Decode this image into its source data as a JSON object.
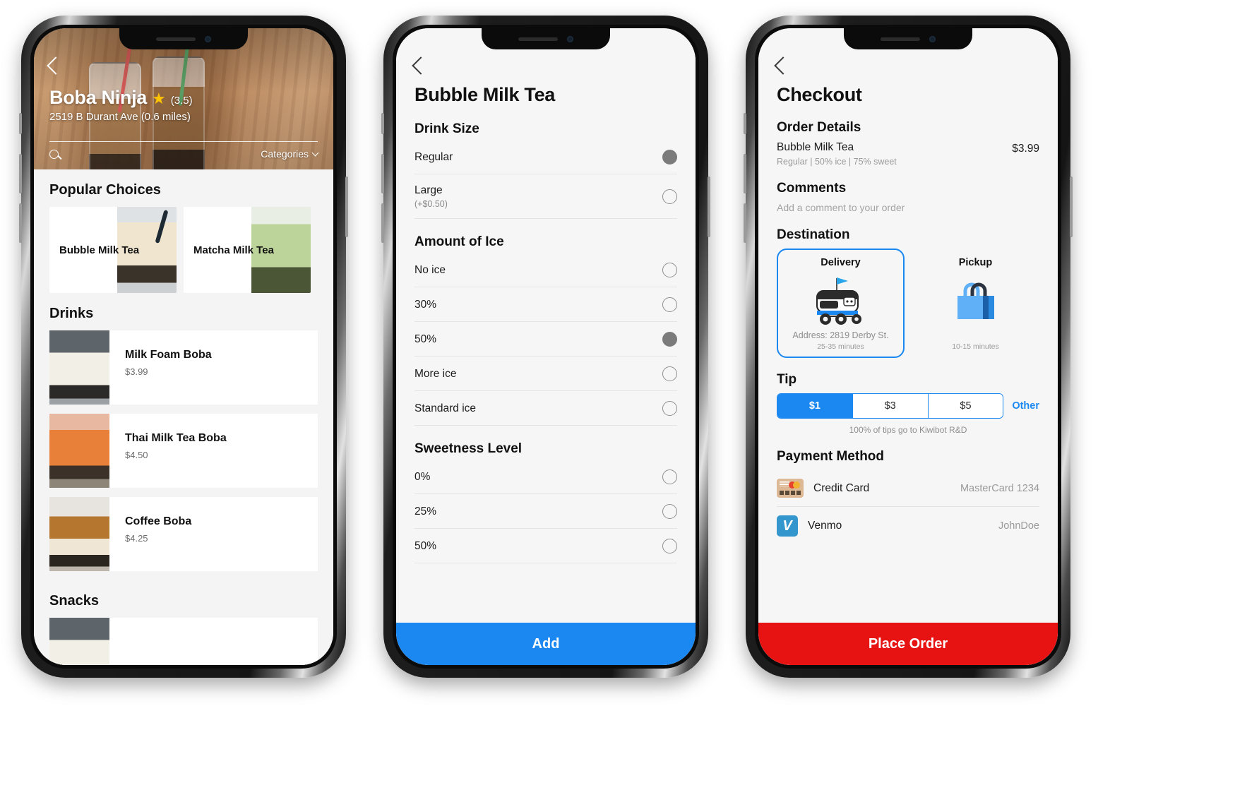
{
  "colors": {
    "accent_blue": "#1a88f0",
    "place_order_red": "#e71313",
    "star_gold": "#ffc400",
    "radio_selected": "#7b7b7b"
  },
  "phone1": {
    "back_icon": "back-chevron-icon",
    "store": {
      "name": "Boba Ninja",
      "star_icon": "star-icon",
      "rating": "(3.5)",
      "address": "2519 B Durant Ave (0.6 miles)"
    },
    "search": {
      "icon": "search-icon",
      "placeholder": ""
    },
    "categories": {
      "label": "Categories",
      "chevron_icon": "chevron-down-icon"
    },
    "sections": [
      {
        "title": "Popular Choices"
      },
      {
        "title": "Drinks"
      },
      {
        "title": "Snacks"
      }
    ],
    "popular": [
      {
        "name": "Bubble Milk Tea",
        "image": "bubble-milk-tea-photo"
      },
      {
        "name": "Matcha Milk Tea",
        "image": "matcha-milk-tea-photo"
      }
    ],
    "drinks": [
      {
        "name": "Milk Foam Boba",
        "price": "$3.99",
        "image": "milk-foam-boba-photo"
      },
      {
        "name": "Thai Milk Tea Boba",
        "price": "$4.50",
        "image": "thai-milk-tea-boba-photo"
      },
      {
        "name": "Coffee Boba",
        "price": "$4.25",
        "image": "coffee-boba-photo"
      }
    ]
  },
  "phone2": {
    "back_icon": "back-chevron-icon",
    "title": "Bubble Milk Tea",
    "groups": [
      {
        "title": "Drink Size",
        "options": [
          {
            "label": "Regular",
            "sub": "",
            "selected": true
          },
          {
            "label": "Large",
            "sub": "(+$0.50)",
            "selected": false
          }
        ]
      },
      {
        "title": "Amount of Ice",
        "options": [
          {
            "label": "No ice",
            "sub": "",
            "selected": false
          },
          {
            "label": "30%",
            "sub": "",
            "selected": false
          },
          {
            "label": "50%",
            "sub": "",
            "selected": true
          },
          {
            "label": "More ice",
            "sub": "",
            "selected": false
          },
          {
            "label": "Standard ice",
            "sub": "",
            "selected": false
          }
        ]
      },
      {
        "title": "Sweetness Level",
        "options": [
          {
            "label": "0%",
            "sub": "",
            "selected": false
          },
          {
            "label": "25%",
            "sub": "",
            "selected": false
          },
          {
            "label": "50%",
            "sub": "",
            "selected": false
          }
        ]
      }
    ],
    "cta": "Add"
  },
  "phone3": {
    "back_icon": "back-chevron-icon",
    "title": "Checkout",
    "order_details": {
      "heading": "Order Details",
      "item_name": "Bubble Milk Tea",
      "item_options": "Regular | 50% ice | 75% sweet",
      "item_price": "$3.99"
    },
    "comments": {
      "heading": "Comments",
      "placeholder": "Add a comment to your order"
    },
    "destination": {
      "heading": "Destination",
      "options": [
        {
          "label": "Delivery",
          "icon": "kiwibot-delivery-robot-icon",
          "address": "Address: 2819 Derby St.",
          "eta": "25-35 minutes",
          "selected": true
        },
        {
          "label": "Pickup",
          "icon": "shopping-bag-icon",
          "address": "",
          "eta": "10-15 minutes",
          "selected": false
        }
      ]
    },
    "tip": {
      "heading": "Tip",
      "options": [
        {
          "label": "$1",
          "active": true
        },
        {
          "label": "$3",
          "active": false
        },
        {
          "label": "$5",
          "active": false
        }
      ],
      "other_label": "Other",
      "note": "100% of tips go to Kiwibot R&D"
    },
    "payment": {
      "heading": "Payment Method",
      "methods": [
        {
          "name": "Credit Card",
          "detail": "MasterCard 1234",
          "icon": "credit-card-icon"
        },
        {
          "name": "Venmo",
          "detail": "JohnDoe",
          "icon": "venmo-icon"
        }
      ]
    },
    "cta": "Place Order"
  }
}
